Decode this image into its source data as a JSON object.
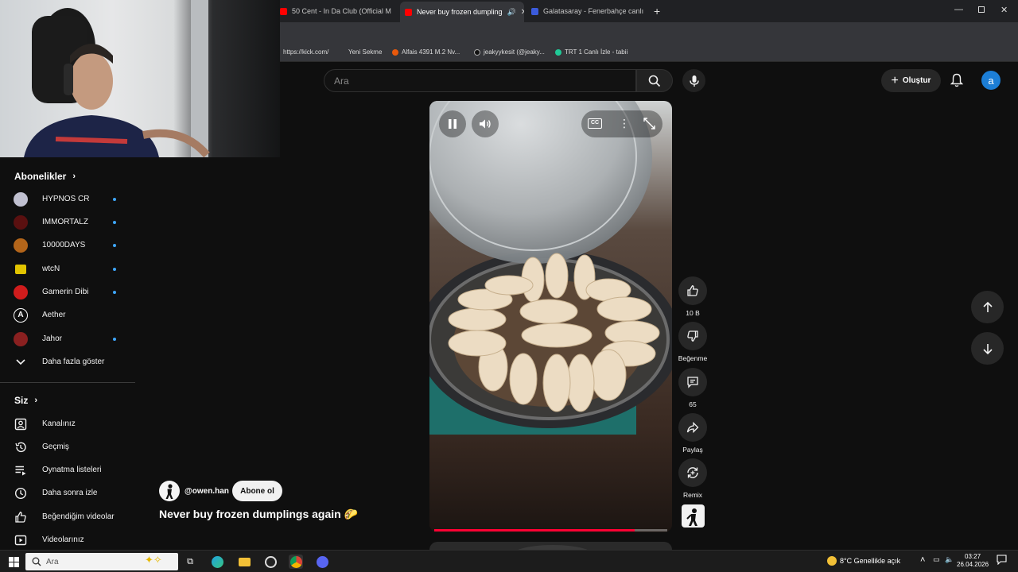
{
  "browser": {
    "tabs": [
      {
        "title": "50 Cent - In Da Club (Official M",
        "favicon_color": "#ff0000",
        "active": false
      },
      {
        "title": "Never buy frozen dumpling",
        "favicon_color": "#ff0000",
        "active": true
      },
      {
        "title": "Galatasaray - Fenerbahçe canlı",
        "favicon_color": "#3b5bdb",
        "active": false
      }
    ],
    "new_tab_icon": "plus-icon",
    "bookmarks": [
      {
        "label": "https://kick.com/",
        "icon": "globe-icon"
      },
      {
        "label": "Yeni Sekme",
        "icon": "page-icon"
      },
      {
        "label": "Alfais 4391 M.2 Nv...",
        "icon": "store-icon"
      },
      {
        "label": "jeakyykesit (@jeaky...",
        "icon": "tiktok-icon"
      },
      {
        "label": "TRT 1 Canlı İzle - tabii",
        "icon": "tabii-icon"
      }
    ]
  },
  "header": {
    "search_placeholder": "Ara",
    "create_label": "Oluştur",
    "avatar_letter": "a"
  },
  "sidebar": {
    "subscriptions_title": "Abonelikler",
    "subscriptions": [
      {
        "name": "HYPNOS CR",
        "color": "#c0c0d0",
        "live": true
      },
      {
        "name": "IMMORTALZ",
        "color": "#5a1010",
        "live": true
      },
      {
        "name": "10000DAYS",
        "color": "#b3651a",
        "live": true
      },
      {
        "name": "wtcN",
        "color": "#e2c400",
        "live": true
      },
      {
        "name": "Gamerin Dibi",
        "color": "#d01c1c",
        "live": true
      },
      {
        "name": "Aether",
        "color": "#ffffff",
        "live": false
      },
      {
        "name": "Jahor",
        "color": "#8a2020",
        "live": true
      }
    ],
    "show_more": "Daha fazla göster",
    "you_title": "Siz",
    "you_items": [
      {
        "label": "Kanalınız",
        "icon": "channel-icon"
      },
      {
        "label": "Geçmiş",
        "icon": "history-icon"
      },
      {
        "label": "Oynatma listeleri",
        "icon": "playlist-icon"
      },
      {
        "label": "Daha sonra izle",
        "icon": "clock-icon"
      },
      {
        "label": "Beğendiğim videolar",
        "icon": "thumb-up-icon"
      },
      {
        "label": "Videolarınız",
        "icon": "video-icon"
      }
    ]
  },
  "short": {
    "channel": "@owen.han",
    "subscribe_label": "Abone ol",
    "title": "Never buy frozen dumplings again 🌮",
    "progress": 0.86,
    "actions": {
      "like_count": "10 B",
      "dislike_label": "Beğenme",
      "comment_count": "65",
      "share_label": "Paylaş",
      "remix_label": "Remix"
    }
  },
  "taskbar": {
    "search_placeholder": "Ara",
    "weather": "8°C  Genellikle açık",
    "time": "03:27",
    "date": "26.04.2026"
  }
}
